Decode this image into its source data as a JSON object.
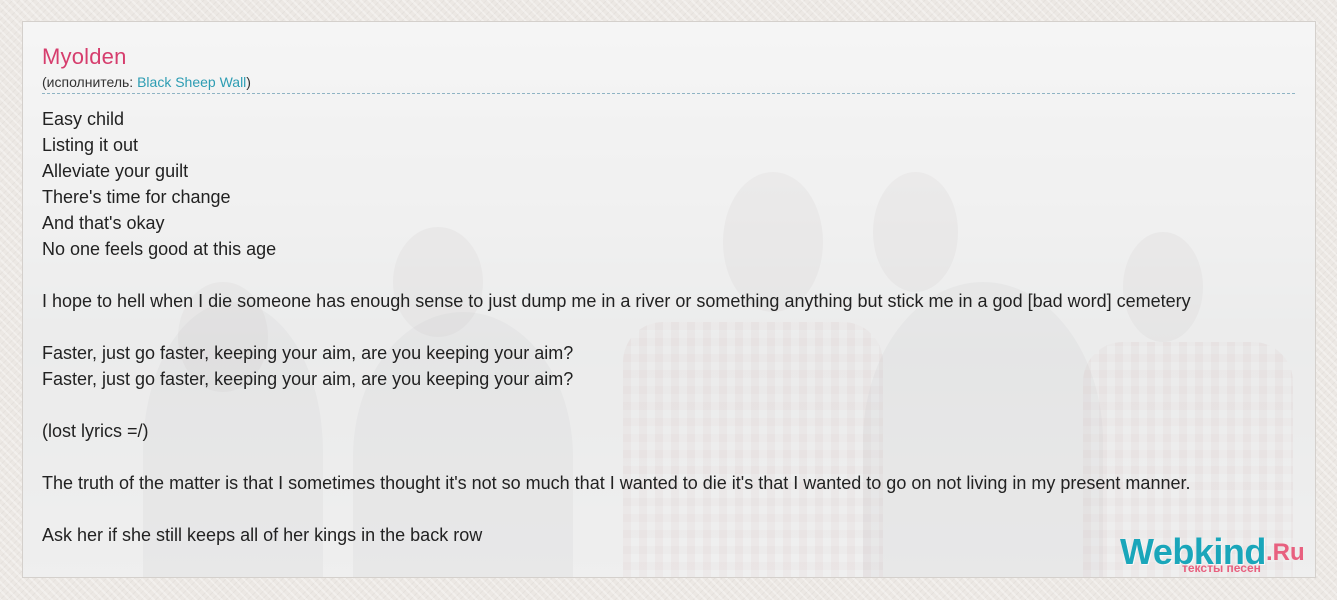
{
  "song": {
    "title": "Myolden",
    "artist_prefix": "(исполнитель: ",
    "artist_name": "Black Sheep Wall",
    "artist_suffix": ")"
  },
  "lyrics": [
    "Easy child",
    "Listing it out",
    "Alleviate your guilt",
    "There's time for change",
    "And that's okay",
    "No one feels good at this age",
    "",
    "I hope to hell when I die someone has enough sense to just dump me in a river or something anything but stick me in a god [bad word] cemetery",
    "",
    "Faster, just go faster, keeping your aim, are you keeping your aim?",
    "Faster, just go faster, keeping your aim, are you keeping your aim?",
    "",
    "(lost lyrics =/)",
    "",
    "The truth of the matter is that I sometimes thought it's not so much that I wanted to die it's that I wanted to go on not living in my present manner.",
    "",
    "Ask her if she still keeps all of her kings in the back row"
  ],
  "logo": {
    "main": "Webkind",
    "tld": ".Ru",
    "tagline": "тексты песен"
  },
  "colors": {
    "title": "#d63d6d",
    "link": "#2d9db3",
    "logo_main": "#1aa6ba",
    "logo_accent": "#e8607f"
  }
}
